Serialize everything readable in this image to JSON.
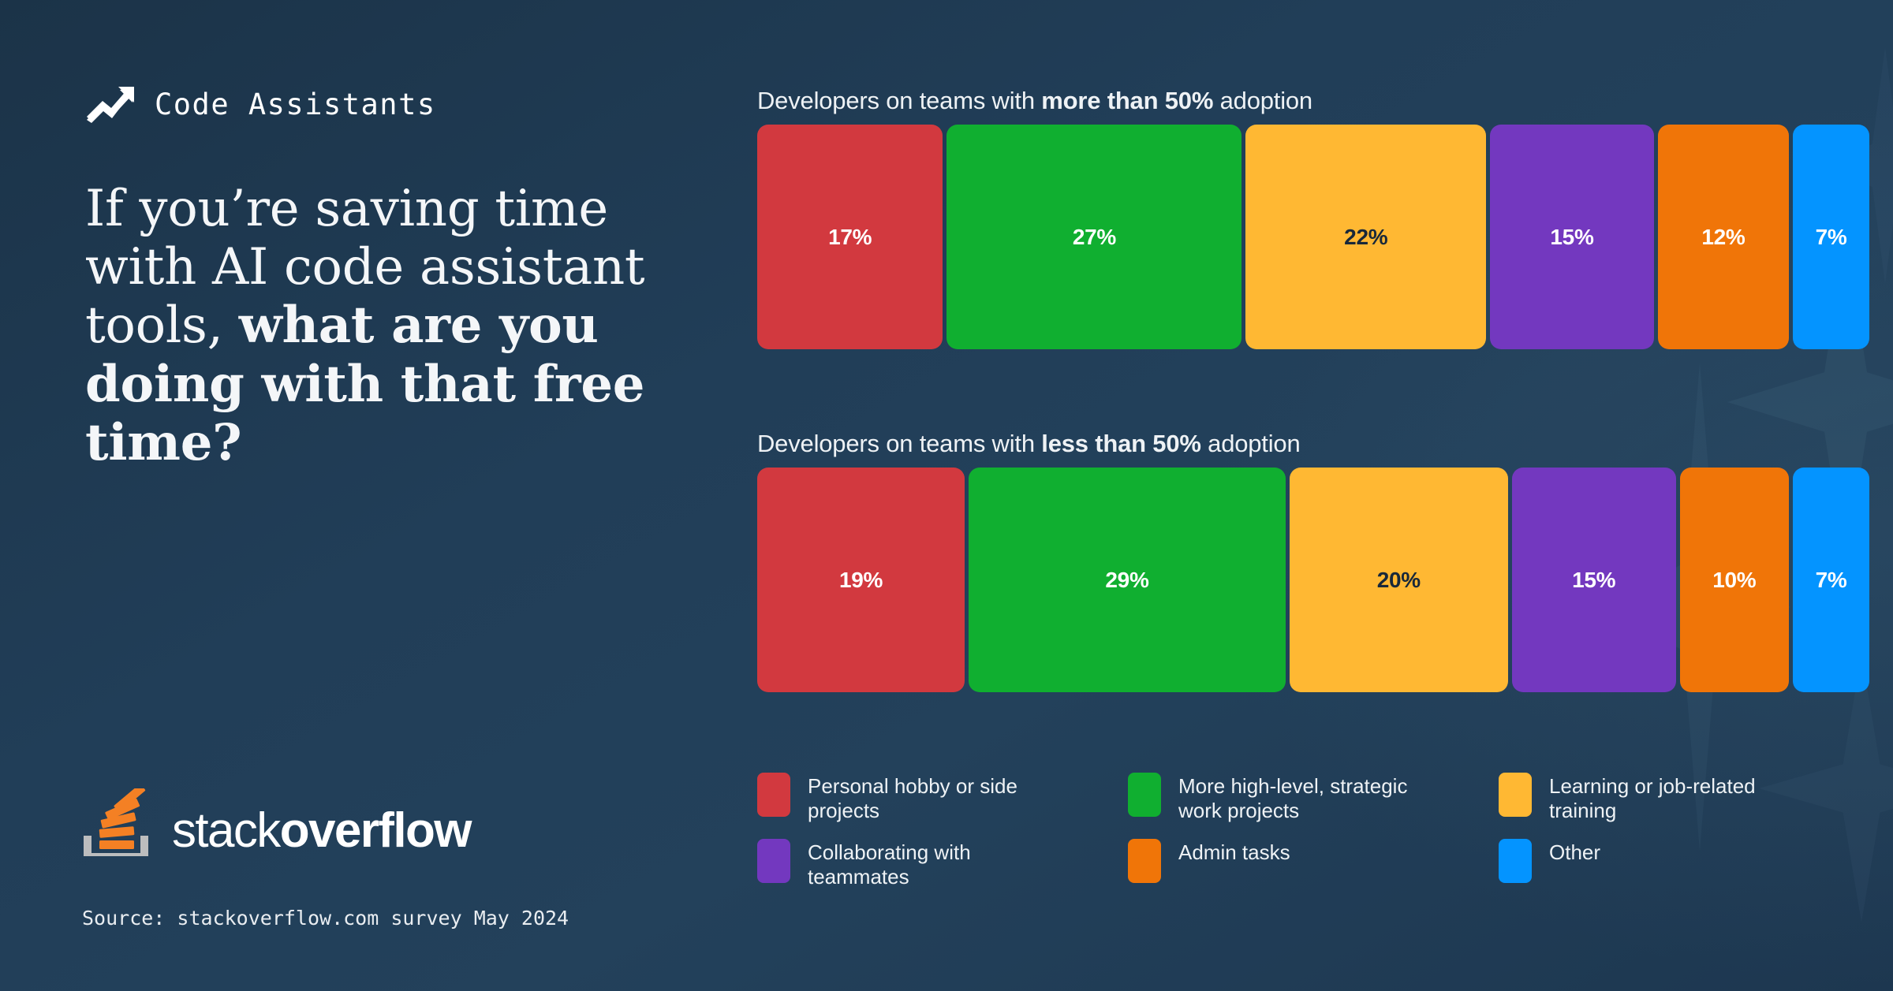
{
  "brand": {
    "background_color": "#203d57",
    "logo_word_light": "stack",
    "logo_word_bold": "overflow",
    "logo_mark_icon": "stack-overflow-logo-icon",
    "source_note": "Source: stackoverflow.com survey May 2024"
  },
  "header": {
    "icon": "trending-up-arrow-icon",
    "eyebrow": "Code Assistants",
    "headline_regular": "If you’re saving time with AI code assistant tools,",
    "headline_bold": "what are you doing with that free time?"
  },
  "chart_data": {
    "type": "bar",
    "title": "If you’re saving time with AI code assistant tools, what are you doing with that free time?",
    "subtitle": "Code Assistants",
    "orientation": "horizontal-stacked",
    "xlabel": "",
    "ylabel": "",
    "grid": false,
    "legend_position": "bottom",
    "unit": "%",
    "categories": [
      "Personal hobby or side projects",
      "More high-level, strategic work projects",
      "Learning or job-related training",
      "Collaborating with teammates",
      "Admin tasks",
      "Other"
    ],
    "colors": [
      "#d2393f",
      "#10af30",
      "#ffb833",
      "#7338bf",
      "#f07508",
      "#0494ff"
    ],
    "label_colors": [
      "#ffffff",
      "#ffffff",
      "#18283a",
      "#ffffff",
      "#ffffff",
      "#ffffff"
    ],
    "series": [
      {
        "name": "Developers on teams with more than 50% adoption",
        "caption_prefix": "Developers on teams with ",
        "caption_strong": "more than 50%",
        "caption_suffix": " adoption",
        "values": [
          17,
          27,
          22,
          15,
          12,
          7
        ],
        "labels": [
          "17%",
          "27%",
          "22%",
          "15%",
          "12%",
          "7%"
        ]
      },
      {
        "name": "Developers on teams with less than 50% adoption",
        "caption_prefix": "Developers on teams with ",
        "caption_strong": "less than 50%",
        "caption_suffix": " adoption",
        "values": [
          19,
          29,
          20,
          15,
          10,
          7
        ],
        "labels": [
          "19%",
          "29%",
          "20%",
          "15%",
          "10%",
          "7%"
        ]
      }
    ]
  },
  "legend": {
    "items": [
      {
        "label": "Personal hobby or side projects",
        "color": "#d2393f",
        "swatch_name": "legend-swatch-personal-hobby"
      },
      {
        "label": "More high-level, strategic work projects",
        "color": "#10af30",
        "swatch_name": "legend-swatch-strategic-work"
      },
      {
        "label": "Learning or job-related training",
        "color": "#ffb833",
        "swatch_name": "legend-swatch-learning-training"
      },
      {
        "label": "Collaborating with teammates",
        "color": "#7338bf",
        "swatch_name": "legend-swatch-collaborating"
      },
      {
        "label": "Admin tasks",
        "color": "#f07508",
        "swatch_name": "legend-swatch-admin-tasks"
      },
      {
        "label": "Other",
        "color": "#0494ff",
        "swatch_name": "legend-swatch-other"
      }
    ]
  }
}
